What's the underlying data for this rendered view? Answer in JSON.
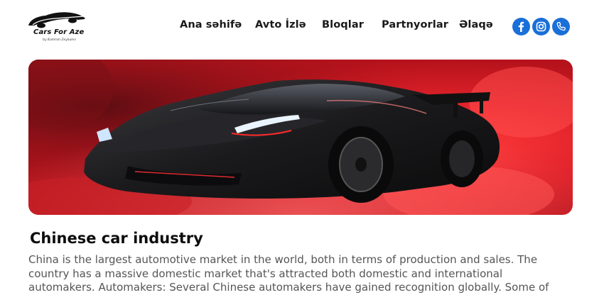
{
  "header": {
    "logo": {
      "title": "Cars For Aze",
      "subtitle": "by Kamran Zeynalov"
    },
    "nav": [
      {
        "label": "Ana səhifə"
      },
      {
        "label": "Avto İzlə"
      },
      {
        "label": "Bloqlar"
      },
      {
        "label": "Partnyorlar"
      },
      {
        "label": "Əlaqə"
      }
    ],
    "social": [
      {
        "icon": "facebook-icon"
      },
      {
        "icon": "instagram-icon"
      },
      {
        "icon": "phone-icon"
      }
    ],
    "accent": "#1a6fd8"
  },
  "hero": {
    "image": "black-sports-car-red-smoke",
    "colors": {
      "smoke": "#e0222a",
      "car": "#111111"
    }
  },
  "article": {
    "title": "Chinese car industry",
    "lines": [
      " China is the largest automotive market in the world, both in terms of production and sales. The",
      "country has a massive domestic market that's attracted both domestic and international",
      "automakers. Automakers: Several Chinese automakers have gained recognition globally. Some of"
    ]
  }
}
